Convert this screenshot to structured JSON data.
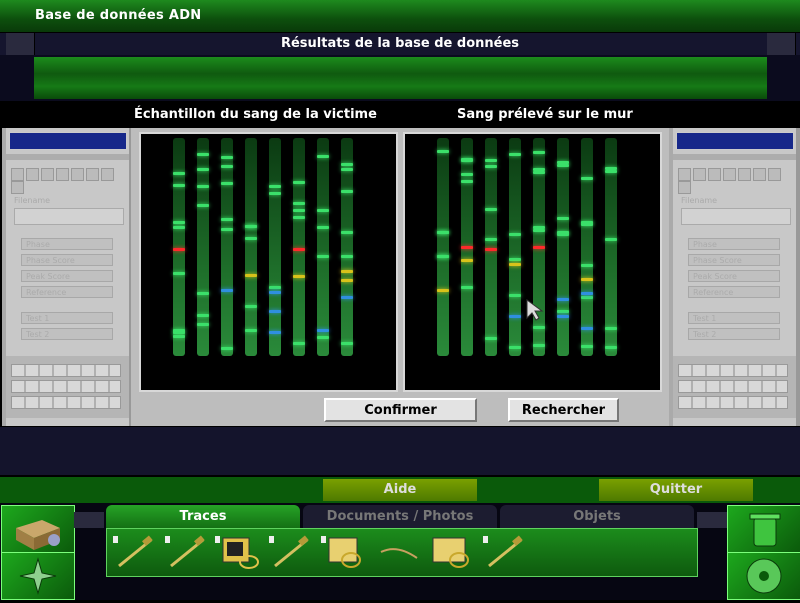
{
  "window": {
    "title": "Base de données ADN"
  },
  "results": {
    "title": "Résultats de la base de données"
  },
  "samples": {
    "left_label": "Échantillon du sang de la victime",
    "right_label": "Sang prélevé sur le mur"
  },
  "side_panel": {
    "field_label": "Filename",
    "buttons": [
      "Phase",
      "Phase Score",
      "Peak Score",
      "Reference",
      "Test 1",
      "Test 2"
    ]
  },
  "actions": {
    "confirm": "Confirmer",
    "search": "Rechercher"
  },
  "command_bar": {
    "help": "Aide",
    "quit": "Quitter"
  },
  "inventory": {
    "tabs": [
      "Traces",
      "Documents / Photos",
      "Objets"
    ],
    "active_tab": "Traces",
    "items": [
      {
        "icon": "swab-icon",
        "locked": true
      },
      {
        "icon": "swab-icon",
        "locked": true
      },
      {
        "icon": "fingerprint-card-icon",
        "locked": true
      },
      {
        "icon": "swab-icon",
        "locked": true
      },
      {
        "icon": "fingerprint-card-icon",
        "locked": true
      },
      {
        "icon": "hair-icon",
        "locked": false
      },
      {
        "icon": "fingerprint-card-icon",
        "locked": false
      },
      {
        "icon": "swab-icon",
        "locked": true
      }
    ]
  },
  "colors": {
    "accent_green": "#1c8c1c",
    "navy": "#14142c",
    "panel_blue": "#17288a"
  }
}
